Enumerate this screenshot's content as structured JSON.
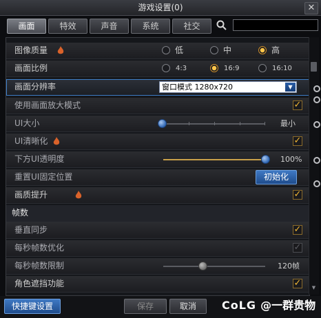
{
  "window": {
    "title": "游戏设置(0)",
    "close_label": "✕"
  },
  "tabs": [
    {
      "label": "画面",
      "active": true
    },
    {
      "label": "特效",
      "active": false
    },
    {
      "label": "声音",
      "active": false
    },
    {
      "label": "系统",
      "active": false
    },
    {
      "label": "社交",
      "active": false
    }
  ],
  "search": {
    "placeholder": "",
    "value": ""
  },
  "settings": {
    "image_quality": {
      "label": "图像质量",
      "options": [
        "低",
        "中",
        "高"
      ],
      "selected": "高"
    },
    "aspect_ratio": {
      "label": "画面比例",
      "options": [
        "4:3",
        "16:9",
        "16:10"
      ],
      "selected": "16:9"
    },
    "resolution": {
      "label": "画面分辨率",
      "value": "窗口模式 1280x720"
    },
    "zoom_mode": {
      "label": "使用画面放大模式",
      "checked": true
    },
    "ui_size": {
      "label": "UI大小",
      "value_label": "最小",
      "level": 0
    },
    "ui_sharpen": {
      "label": "UI清晰化",
      "checked": true
    },
    "bottom_ui_opacity": {
      "label": "下方UI透明度",
      "value_label": "100%",
      "level": 1
    },
    "reset_ui": {
      "label": "重置UI固定位置",
      "button": "初始化"
    },
    "quality_boost": {
      "label": "画质提升",
      "checked": true
    },
    "fps_section": {
      "label": "帧数"
    },
    "vsync": {
      "label": "垂直同步",
      "checked": true
    },
    "fps_optimize": {
      "label": "每秒帧数优化",
      "checked": true,
      "disabled": true
    },
    "fps_limit": {
      "label": "每秒帧数限制",
      "value_label": "120帧",
      "level": 0.33
    },
    "occlusion": {
      "label": "角色遮挡功能",
      "checked": true
    }
  },
  "footer": {
    "quick_key": "快捷键设置",
    "save": "保存",
    "cancel": "取消"
  },
  "watermark": {
    "logo": "CoLG",
    "text": "@一群贵物"
  },
  "colors": {
    "accent_gold": "#f2b734",
    "accent_blue": "#2f66b3"
  }
}
